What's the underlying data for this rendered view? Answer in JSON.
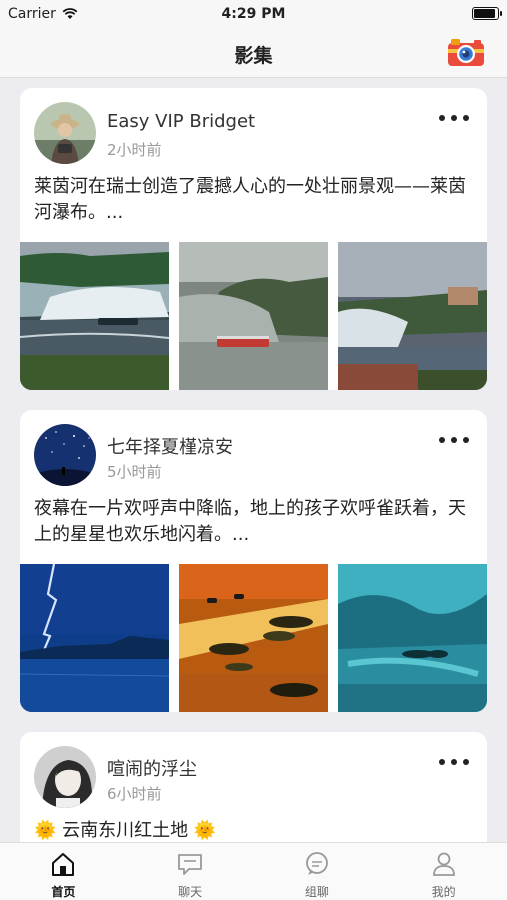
{
  "status": {
    "carrier": "Carrier",
    "time": "4:29 PM"
  },
  "nav": {
    "title": "影集",
    "camera_icon": "camera-icon"
  },
  "posts": [
    {
      "user": "Easy VIP Bridget",
      "time": "2小时前",
      "text": "莱茵河在瑞士创造了震撼人心的一处壮丽景观——莱茵河瀑布。..."
    },
    {
      "user": "七年择夏槿凉安",
      "time": "5小时前",
      "text": "夜幕在一片欢呼声中降临，地上的孩子欢呼雀跃着，天上的星星也欢乐地闪着。..."
    },
    {
      "user": "喧闹的浮尘",
      "time": "6小时前",
      "text": "🌞 云南东川红土地 🌞"
    }
  ],
  "tabs": [
    {
      "label": "首页",
      "icon": "home-icon",
      "active": true
    },
    {
      "label": "聊天",
      "icon": "chat-icon",
      "active": false
    },
    {
      "label": "组聊",
      "icon": "group-chat-icon",
      "active": false
    },
    {
      "label": "我的",
      "icon": "profile-icon",
      "active": false
    }
  ],
  "colors": {
    "background": "#ececf1",
    "card": "#ffffff",
    "navbar": "#f7f7f7",
    "camera": "#e94c3d"
  }
}
